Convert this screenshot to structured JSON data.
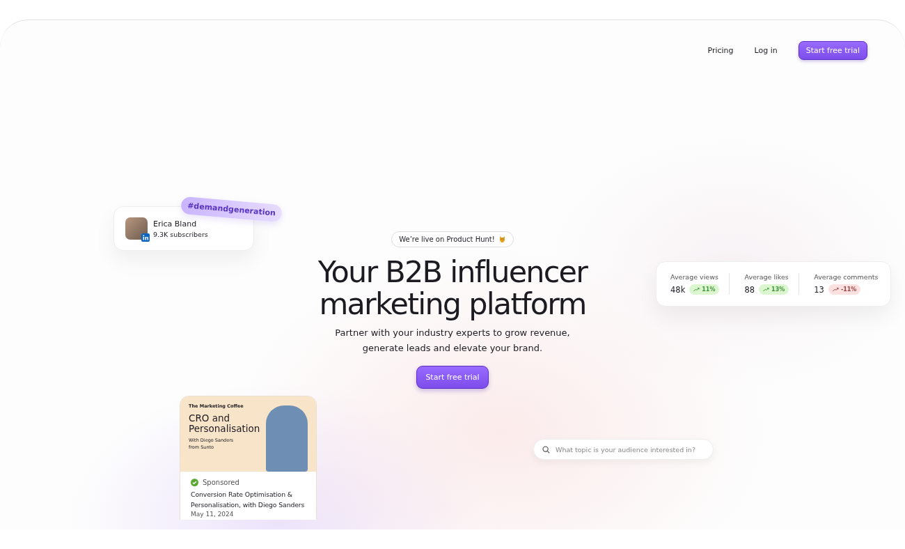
{
  "nav": {
    "links": [
      "Pricing",
      "Log in"
    ],
    "cta": "Start free trial"
  },
  "profile_card": {
    "name": "Erica Bland",
    "subscribers": "9.3K subscribers",
    "hashtag": "#demandgeneration"
  },
  "announcement": "We’re live on Product Hunt!",
  "headline": [
    "Your B2B influencer",
    "marketing platform"
  ],
  "subtitle": [
    "Partner with your industry experts to grow revenue,",
    "generate leads and elevate your brand."
  ],
  "cta": "Start free trial",
  "stats": [
    {
      "label": "Average views",
      "value": "48k",
      "change": "11%",
      "color": "#dcf7cf"
    },
    {
      "label": "Average likes",
      "value": "88",
      "change": "13%",
      "color": "#dcf7cf"
    },
    {
      "label": "Average comments",
      "value": "13",
      "change": "-11%",
      "color": "#fde0e0"
    }
  ],
  "post_card": {
    "brand": "The Marketing Coffee",
    "banner_title": "CRO and Personalisation",
    "banner_byline": [
      "With Diego Sanders",
      "from Sunto"
    ],
    "badge": "Sponsored",
    "title": "Conversion Rate Optimisation & Personalisation, with Diego Sanders",
    "date": "May 11, 2024"
  },
  "search": {
    "placeholder": "What topic is your audience interested in?"
  }
}
